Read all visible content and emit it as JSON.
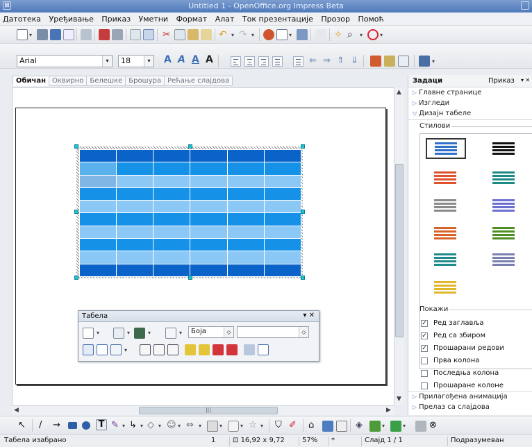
{
  "window": {
    "title": "Untitled 1 - OpenOffice.org Impress Beta"
  },
  "menu": [
    "Датотека",
    "Уређивање",
    "Приказ",
    "Уметни",
    "Формат",
    "Алат",
    "Ток презентације",
    "Прозор",
    "Помоћ"
  ],
  "format_toolbar": {
    "font_name": "Arial",
    "font_size": "18"
  },
  "view_tabs": [
    "Обичан",
    "Оквирно",
    "Белешке",
    "Брошура",
    "Рећање слајдова"
  ],
  "table_colors": {
    "header": "#0A63C9",
    "row_dark": "#1591E8",
    "row_light": "#8CC8F5",
    "row_mid": "#3BA6EE",
    "cell_hl": "#5BB1EC"
  },
  "table_toolbar": {
    "title": "Табела",
    "color_mode": "Боја",
    "color_value": ""
  },
  "task_panel": {
    "title": "Задаци",
    "view_label": "Приказ",
    "sections": [
      {
        "label": "Главне странице",
        "expanded": false
      },
      {
        "label": "Изгледи",
        "expanded": false
      },
      {
        "label": "Дизајн табеле",
        "expanded": true
      }
    ],
    "styles_label": "Стилови",
    "show_label": "Покажи",
    "options": [
      {
        "label": "Ред заглавља",
        "checked": true
      },
      {
        "label": "Ред са збиром",
        "checked": true
      },
      {
        "label": "Прошарани редови",
        "checked": true
      },
      {
        "label": "Прва колона",
        "checked": false
      },
      {
        "label": "Последња колона",
        "checked": false
      },
      {
        "label": "Прошаране колоне",
        "checked": false
      }
    ],
    "collapsed_sections": [
      "Прилагођена анимација",
      "Прелаз са слајдова"
    ],
    "swatch_colors": [
      "#2f6fc9",
      "#111111",
      "#e0522e",
      "#1c8b84",
      "#8a8a8a",
      "#6b6fcf",
      "#d9622a",
      "#4f8e22",
      "#1e8a8a",
      "#7a7fb0",
      "#e2b62a"
    ]
  },
  "statusbar": {
    "mode": "Табела изабрано",
    "position": "1",
    "size": "16,92 x 9,72",
    "zoom": "57%",
    "modified": "*",
    "slide": "Слајд 1 / 1",
    "layout": "Подразумеван"
  }
}
